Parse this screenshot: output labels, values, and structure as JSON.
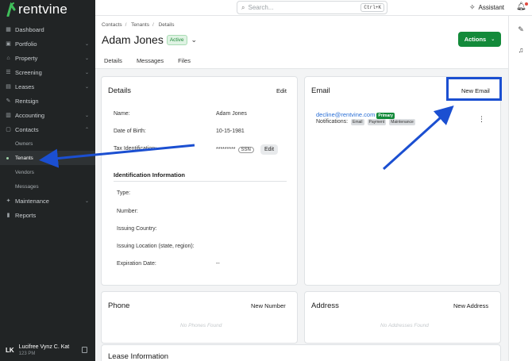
{
  "app": {
    "logo_text": "rentvine"
  },
  "sidebar": {
    "items": [
      {
        "label": "Dashboard",
        "icon": "dashboard-icon",
        "chevron": ""
      },
      {
        "label": "Portfolio",
        "icon": "portfolio-icon",
        "chevron": "⌄"
      },
      {
        "label": "Property",
        "icon": "property-icon",
        "chevron": "⌄"
      },
      {
        "label": "Screening",
        "icon": "screening-icon",
        "chevron": "⌄"
      },
      {
        "label": "Leases",
        "icon": "leases-icon",
        "chevron": "⌄"
      },
      {
        "label": "Rentsign",
        "icon": "rentsign-icon",
        "chevron": ""
      },
      {
        "label": "Accounting",
        "icon": "accounting-icon",
        "chevron": "⌄"
      },
      {
        "label": "Contacts",
        "icon": "contacts-icon",
        "chevron": "⌃"
      }
    ],
    "contacts_sub": [
      "Owners",
      "Tenants",
      "Vendors",
      "Messages"
    ],
    "items_after": [
      {
        "label": "Maintenance",
        "icon": "maintenance-icon",
        "chevron": "⌄"
      },
      {
        "label": "Reports",
        "icon": "reports-icon",
        "chevron": ""
      }
    ],
    "user": {
      "initials": "LK",
      "name": "Lucifree Vynz C. Kat",
      "sub": "123 PM"
    }
  },
  "topbar": {
    "search_placeholder": "Search...",
    "shortcut": "Ctrl+K",
    "assistant": "Assistant"
  },
  "breadcrumb": [
    "Contacts",
    "Tenants",
    "Details"
  ],
  "page": {
    "title": "Adam Jones",
    "status": "Active",
    "actions_label": "Actions"
  },
  "tabs": [
    "Details",
    "Messages",
    "Files"
  ],
  "details": {
    "title": "Details",
    "edit": "Edit",
    "fields": [
      {
        "label": "Name:",
        "value": "Adam Jones"
      },
      {
        "label": "Date of Birth:",
        "value": "10-15-1981"
      },
      {
        "label": "Tax Identification:",
        "value": "*********"
      }
    ],
    "ssn_badge": "SSN",
    "tax_edit": "Edit",
    "id_section": "Identification Information",
    "id_fields": [
      {
        "label": "Type:",
        "value": ""
      },
      {
        "label": "Number:",
        "value": ""
      },
      {
        "label": "Issuing Country:",
        "value": ""
      },
      {
        "label": "Issuing Location (state, region):",
        "value": ""
      },
      {
        "label": "Expiration Date:",
        "value": "--"
      }
    ]
  },
  "email": {
    "title": "Email",
    "new_label": "New Email",
    "address": "decline@rentvine.com",
    "primary": "Primary",
    "notifications_label": "Notifications:",
    "tags": [
      "Email",
      "Payment",
      "Maintenance"
    ]
  },
  "phone": {
    "title": "Phone",
    "new_label": "New Number",
    "empty": "No Phones Found"
  },
  "address": {
    "title": "Address",
    "new_label": "New Address",
    "empty": "No Addresses Found"
  },
  "lease": {
    "title": "Lease Information"
  },
  "colors": {
    "brand_green": "#138a3a",
    "annotation_blue": "#1b4fd1",
    "sidebar_bg": "#212425",
    "link_blue": "#2a6fd6"
  }
}
